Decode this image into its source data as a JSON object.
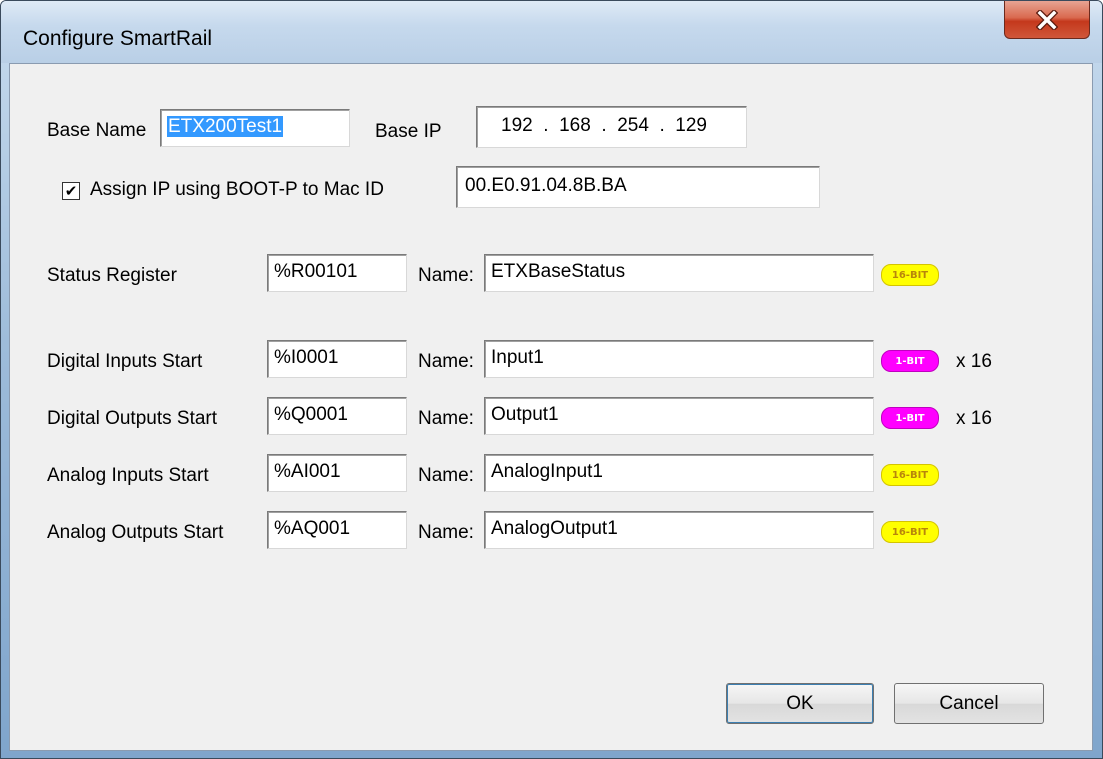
{
  "window": {
    "title": "Configure SmartRail",
    "close_glyph": "X"
  },
  "base": {
    "name_label": "Base Name",
    "name_value": "ETX200Test1",
    "ip_label": "Base IP",
    "ip_value": "192  .  168  .  254  .  129"
  },
  "boot_p": {
    "checked": true,
    "check_glyph": "✔",
    "label": "Assign IP using BOOT-P to Mac ID",
    "mac_value": "00.E0.91.04.8B.BA"
  },
  "name_label": "Name:",
  "rows": [
    {
      "label": "Status Register",
      "address": "%R00101",
      "name": "ETXBaseStatus",
      "badge": "16-BIT",
      "badge_type": "16-bit",
      "multiplier": ""
    },
    {
      "label": "Digital Inputs Start",
      "address": "%I0001",
      "name": "Input1",
      "badge": "1-BIT",
      "badge_type": "1-bit",
      "multiplier": "x 16"
    },
    {
      "label": "Digital Outputs Start",
      "address": "%Q0001",
      "name": "Output1",
      "badge": "1-BIT",
      "badge_type": "1-bit",
      "multiplier": "x 16"
    },
    {
      "label": "Analog Inputs Start",
      "address": "%AI001",
      "name": "AnalogInput1",
      "badge": "16-BIT",
      "badge_type": "16-bit",
      "multiplier": ""
    },
    {
      "label": "Analog Outputs Start",
      "address": "%AQ001",
      "name": "AnalogOutput1",
      "badge": "16-BIT",
      "badge_type": "16-bit",
      "multiplier": ""
    }
  ],
  "buttons": {
    "ok": "OK",
    "cancel": "Cancel"
  },
  "colors": {
    "badge_16bit": "#ffff00",
    "badge_1bit": "#ff00ff",
    "selection": "#3399ff",
    "close_button": "#c4381c"
  }
}
